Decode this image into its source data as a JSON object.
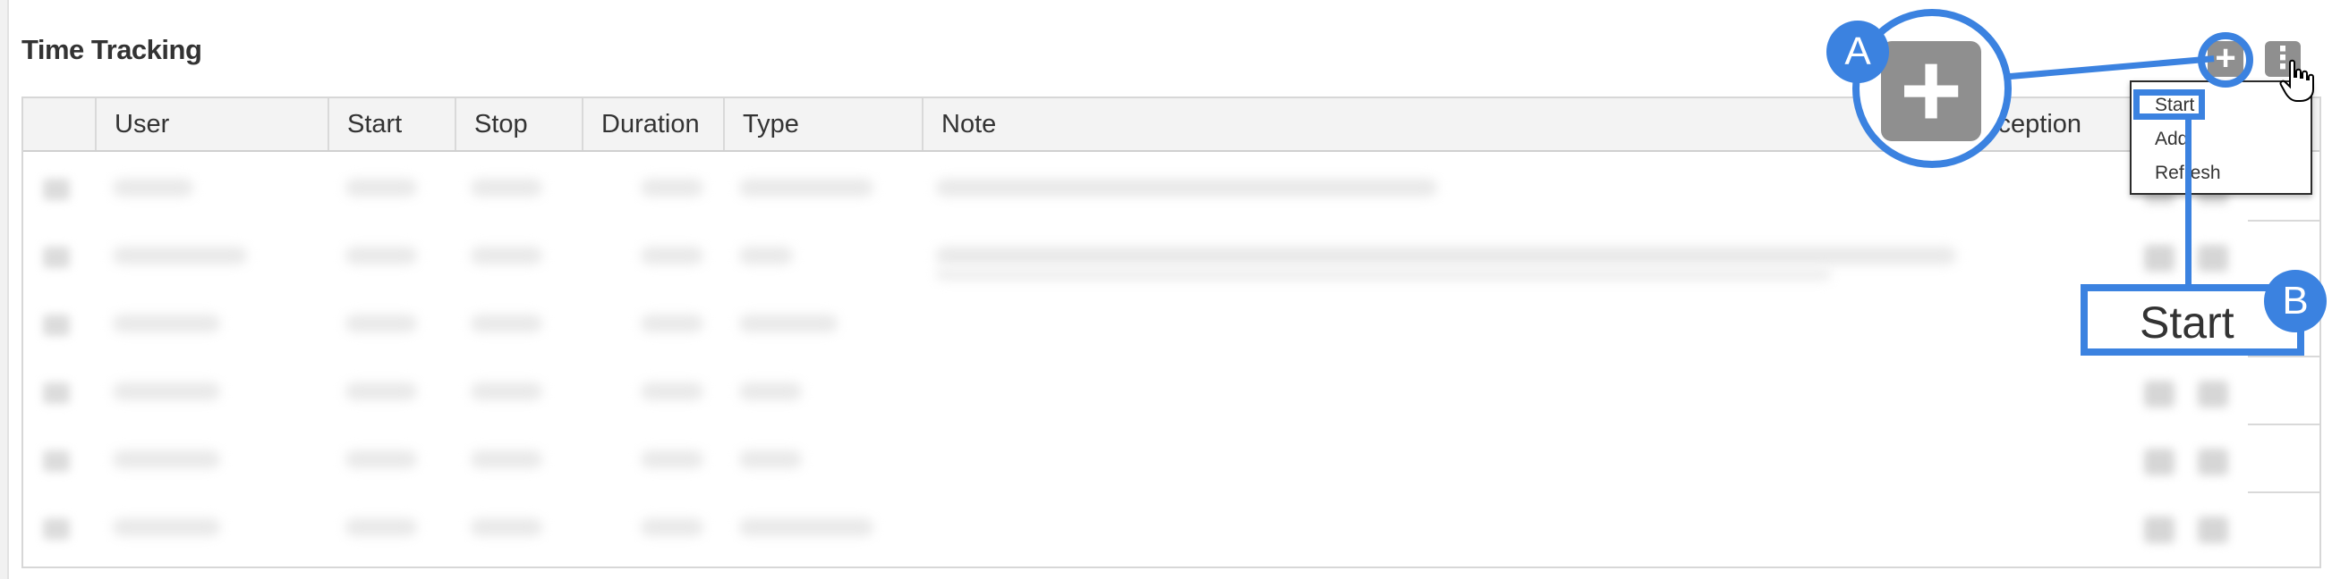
{
  "panel": {
    "title": "Time Tracking"
  },
  "table": {
    "columns": [
      "User",
      "Start",
      "Stop",
      "Duration",
      "Type",
      "Note",
      "Exception"
    ],
    "visible_exception_text": "xception",
    "rows_count_label": "",
    "rows": [
      {
        "blurred": true
      },
      {
        "blurred": true
      },
      {
        "blurred": true
      },
      {
        "blurred": true
      },
      {
        "blurred": true
      },
      {
        "blurred": true
      }
    ]
  },
  "toolbar": {
    "add_icon": "plus-icon",
    "more_icon": "kebab-menu-icon"
  },
  "dropdown": {
    "items": [
      "Start",
      "Add",
      "Refresh"
    ]
  },
  "callouts": {
    "a_label": "A",
    "b_label": "B",
    "zoomed_text": "Start"
  },
  "colors": {
    "accent": "#3b82e0",
    "button_gray": "#8f8f8f",
    "header_bg": "#f3f3f3"
  }
}
